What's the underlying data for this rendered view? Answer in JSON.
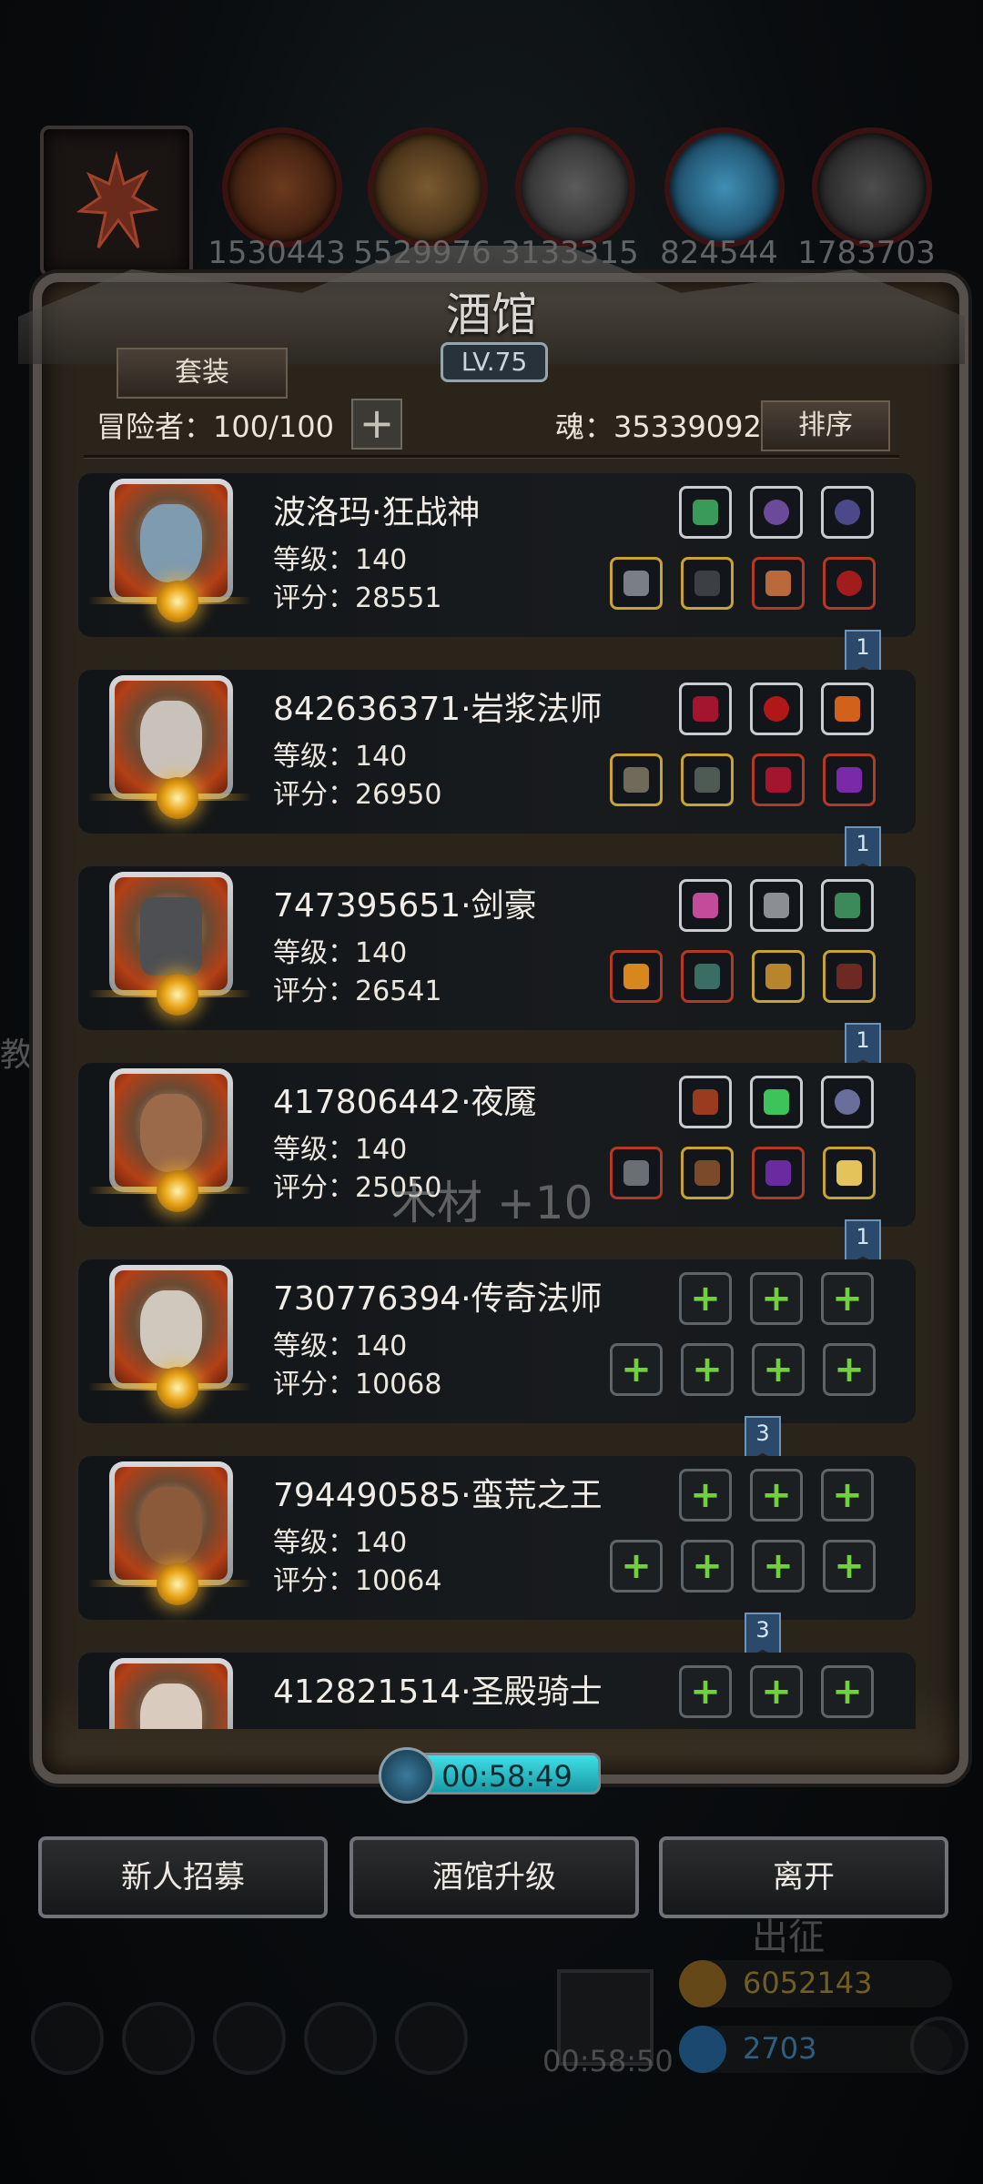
{
  "title": "酒馆",
  "level": "LV.75",
  "suit_button": "套装",
  "adventurer_label": "冒险者：100/100",
  "soul_label": "魂：35339092",
  "sort_button": "排序",
  "resources": [
    {
      "icon": "tree-root-icon",
      "value": ""
    },
    {
      "icon": "meat-icon",
      "value": "1530443"
    },
    {
      "icon": "wood-plank-icon",
      "value": "5529976"
    },
    {
      "icon": "iron-ingot-icon",
      "value": "3133315"
    },
    {
      "icon": "crystal-icon",
      "value": "824544"
    },
    {
      "icon": "stone-block-icon",
      "value": "1783703"
    }
  ],
  "heroes": [
    {
      "name": "波洛玛·狂战神",
      "level": "等级：140",
      "score": "评分：28551",
      "bookmark": "1"
    },
    {
      "name": "842636371·岩浆法师",
      "level": "等级：140",
      "score": "评分：26950",
      "bookmark": "1"
    },
    {
      "name": "747395651·剑豪",
      "level": "等级：140",
      "score": "评分：26541",
      "bookmark": "1"
    },
    {
      "name": "417806442·夜魇",
      "level": "等级：140",
      "score": "评分：25050",
      "bookmark": "1"
    },
    {
      "name": "730776394·传奇法师",
      "level": "等级：140",
      "score": "评分：10068",
      "bookmark": "3"
    },
    {
      "name": "794490585·蛮荒之王",
      "level": "等级：140",
      "score": "评分：10064",
      "bookmark": "3"
    },
    {
      "name": "412821514·圣殿骑士",
      "level": "",
      "score": "",
      "bookmark": ""
    }
  ],
  "floating_text": "木材 +10",
  "timer": "00:58:49",
  "buttons": {
    "recruit": "新人招募",
    "upgrade": "酒馆升级",
    "leave": "离开"
  },
  "background": {
    "expedition": "出征",
    "timer2": "00:58:50",
    "gold": "6052143",
    "gems": "2703",
    "side": "教"
  },
  "colors": {
    "accent": "#3ee0e6",
    "plus_green": "#6fd23a",
    "badge_gold": "#f6b52a"
  }
}
